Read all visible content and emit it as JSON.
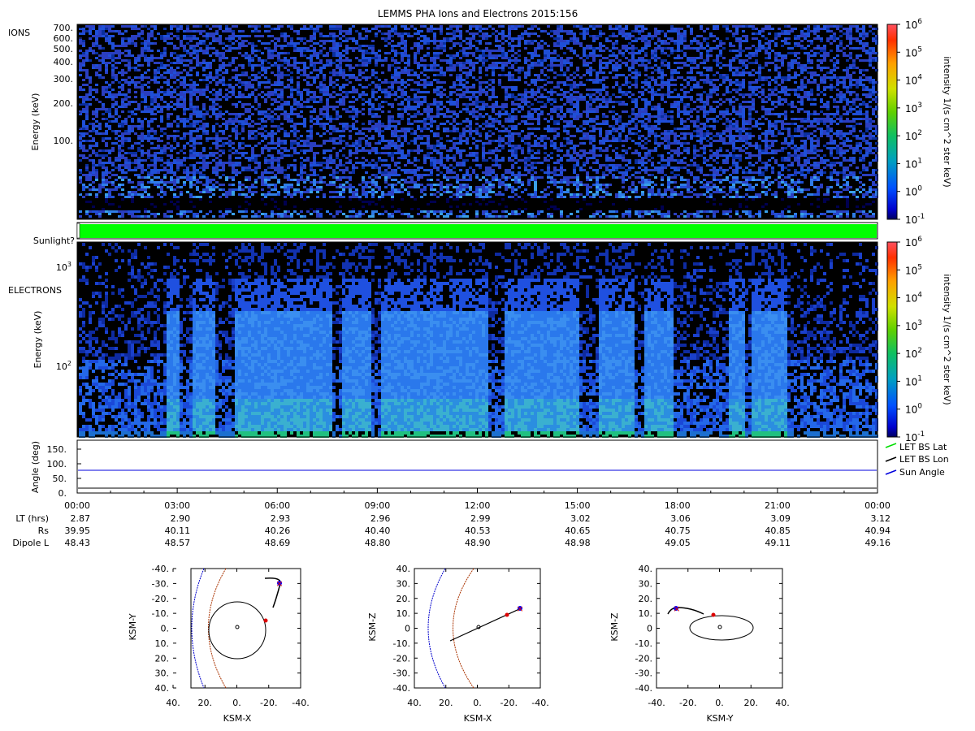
{
  "title": "LEMMS PHA Ions and Electrons  2015:156",
  "colors": {
    "sunlight": "#00ff00",
    "let_bs_lat": "#00dd00",
    "let_bs_lon": "#000000",
    "sun_angle": "#0000dd",
    "bow_shock": "#0000cc",
    "magnetopause": "#aa3300",
    "marker_red": "#dd0000",
    "marker_blue": "#0000ff"
  },
  "colorbar": {
    "ticks": [
      {
        "base": "10",
        "exp": "6"
      },
      {
        "base": "10",
        "exp": "5"
      },
      {
        "base": "10",
        "exp": "4"
      },
      {
        "base": "10",
        "exp": "3"
      },
      {
        "base": "10",
        "exp": "2"
      },
      {
        "base": "10",
        "exp": "1"
      },
      {
        "base": "10",
        "exp": "0"
      },
      {
        "base": "10",
        "exp": "-1"
      }
    ],
    "label": "intensity 1/(s cm^2 ster keV)"
  },
  "ions_panel": {
    "name": "IONS",
    "ylabel": "Energy (keV)",
    "ticks": [
      "700.",
      "600.",
      "500.",
      "400.",
      "300.",
      "200.",
      "100."
    ]
  },
  "sunlight_panel": {
    "label": "Sunlight?"
  },
  "electrons_panel": {
    "name": "ELECTRONS",
    "ylabel": "Energy (keV)",
    "ticks": [
      {
        "base": "10",
        "exp": "3"
      },
      {
        "base": "10",
        "exp": "2"
      }
    ]
  },
  "angle_panel": {
    "ylabel": "Angle (deg)",
    "ticks": [
      "150.",
      "100.",
      "50.",
      "0."
    ],
    "legend": [
      "LET BS Lat",
      "LET BS Lon",
      "Sun Angle"
    ]
  },
  "ephemeris": {
    "times": [
      "00:00",
      "03:00",
      "06:00",
      "09:00",
      "12:00",
      "15:00",
      "18:00",
      "21:00",
      "00:00"
    ],
    "rows": [
      {
        "label": "LT (hrs)",
        "values": [
          "2.87",
          "2.90",
          "2.93",
          "2.96",
          "2.99",
          "3.02",
          "3.06",
          "3.09",
          "3.12"
        ]
      },
      {
        "label": "Rs",
        "values": [
          "39.95",
          "40.11",
          "40.26",
          "40.40",
          "40.53",
          "40.65",
          "40.75",
          "40.85",
          "40.94"
        ]
      },
      {
        "label": "Dipole L",
        "values": [
          "48.43",
          "48.57",
          "48.69",
          "48.80",
          "48.90",
          "48.98",
          "49.05",
          "49.11",
          "49.16"
        ]
      }
    ]
  },
  "orbit_plots": [
    {
      "xlabel": "KSM-X",
      "ylabel": "KSM-Y",
      "xticks": [
        "40.",
        "20.",
        "0.",
        "-20.",
        "-40."
      ],
      "yticks": [
        "-40.",
        "-30.",
        "-20.",
        "-10.",
        "0.",
        "10.",
        "20.",
        "30.",
        "40."
      ]
    },
    {
      "xlabel": "KSM-X",
      "ylabel": "KSM-Z",
      "xticks": [
        "40.",
        "20.",
        "0.",
        "-20.",
        "-40."
      ],
      "yticks": [
        "40.",
        "30.",
        "20.",
        "10.",
        "0",
        "-10.",
        "-20.",
        "-30.",
        "-40."
      ]
    },
    {
      "xlabel": "KSM-Y",
      "ylabel": "KSM-Z",
      "xticks": [
        "-40.",
        "-20.",
        "0.",
        "20.",
        "40."
      ],
      "yticks": [
        "40.",
        "30.",
        "20.",
        "10.",
        "0",
        "-10.",
        "-20.",
        "-30.",
        "-40."
      ]
    }
  ],
  "chart_data": [
    {
      "type": "heatmap",
      "title": "LEMMS PHA Ions and Electrons  2015:156",
      "ylabel": "Energy (keV)",
      "yscale": "log",
      "xlim": [
        "00:00",
        "00:00"
      ],
      "zlabel": "intensity 1/(s cm^2 ster keV)",
      "zlim": [
        0.1,
        1000000
      ],
      "zscale": "log",
      "description_values": {
        "typical_intensity": [
          0.3,
          3
        ]
      }
    },
    {
      "type": "heatmap",
      "ylabel": "Energy (keV)",
      "yscale": "log",
      "zlabel": "intensity 1/(s cm^2 ster keV)",
      "zlim": [
        0.1,
        1000000
      ],
      "zscale": "log",
      "intensity_bursts_hours": [
        [
          2.6,
          3.0
        ],
        [
          3.4,
          4.1
        ],
        [
          4.7,
          7.6
        ],
        [
          7.9,
          8.8
        ],
        [
          9.1,
          12.3
        ],
        [
          12.8,
          15.0
        ],
        [
          15.6,
          16.7
        ],
        [
          17.0,
          17.8
        ],
        [
          19.5,
          20.0
        ],
        [
          20.2,
          21.2
        ]
      ]
    },
    {
      "type": "line",
      "ylabel": "Angle (deg)",
      "ylim": [
        0,
        180
      ],
      "x": [
        "00:00",
        "03:00",
        "06:00",
        "09:00",
        "12:00",
        "15:00",
        "18:00",
        "21:00",
        "00:00"
      ],
      "series": [
        {
          "name": "LET BS Lon",
          "values": [
            10,
            10,
            10,
            10,
            10,
            10,
            10,
            10,
            10
          ]
        },
        {
          "name": "Sun Angle",
          "values": [
            75,
            75,
            75,
            75,
            75,
            75,
            75,
            75,
            75
          ]
        }
      ]
    },
    {
      "type": "scatter",
      "xlabel": "KSM-X",
      "ylabel": "KSM-Y",
      "xlim": [
        40,
        -40
      ],
      "ylim": [
        -40,
        40
      ],
      "marker_red": {
        "x": -18,
        "y": 4
      },
      "marker_end": {
        "x": -27,
        "y": -28
      }
    },
    {
      "type": "scatter",
      "xlabel": "KSM-X",
      "ylabel": "KSM-Z",
      "xlim": [
        40,
        -40
      ],
      "ylim": [
        -40,
        40
      ],
      "trajectory": [
        {
          "x": 18,
          "y": -12
        },
        {
          "x": -27,
          "y": 12
        }
      ],
      "marker_red": {
        "x": -18,
        "y": 8
      }
    },
    {
      "type": "scatter",
      "xlabel": "KSM-Y",
      "ylabel": "KSM-Z",
      "xlim": [
        -40,
        40
      ],
      "ylim": [
        -40,
        40
      ],
      "marker_red": {
        "x": -4,
        "y": 8
      },
      "marker_end": {
        "x": -28,
        "y": 12
      }
    }
  ]
}
